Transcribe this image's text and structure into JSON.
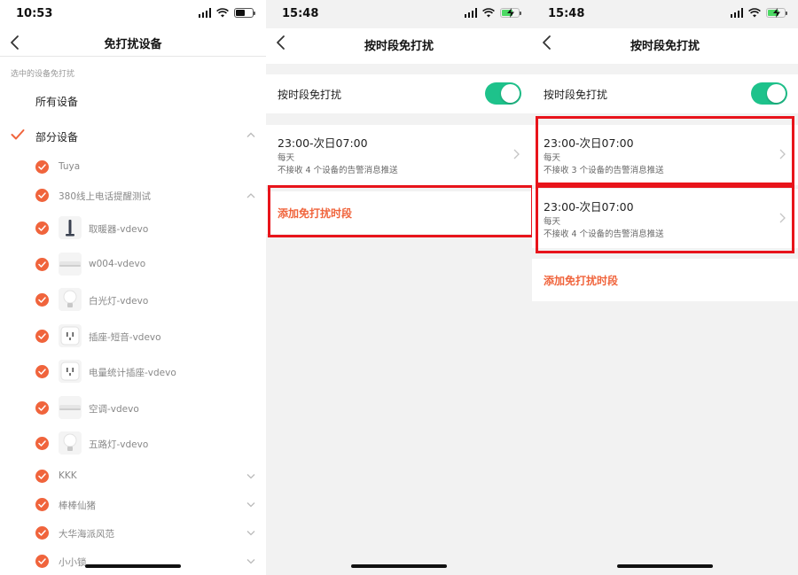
{
  "colors": {
    "accent": "#f0643c",
    "toggle_on": "#1ec28b",
    "highlight": "#e8141b"
  },
  "screen1": {
    "time": "10:53",
    "title": "免打扰设备",
    "section_label": "选中的设备免打扰",
    "options": [
      {
        "label": "所有设备",
        "checked": false
      },
      {
        "label": "部分设备",
        "checked": true
      }
    ],
    "devices": [
      {
        "label": "Tuya",
        "expand": "none",
        "icon": "none"
      },
      {
        "label": "380线上电话提醒测试",
        "expand": "up",
        "icon": "none"
      },
      {
        "label": "取暖器-vdevo",
        "expand": "none",
        "icon": "heater-icon"
      },
      {
        "label": "w004-vdevo",
        "expand": "none",
        "icon": "sensor-icon"
      },
      {
        "label": "白光灯-vdevo",
        "expand": "none",
        "icon": "bulb-icon"
      },
      {
        "label": "插座-短音-vdevo",
        "expand": "none",
        "icon": "socket-icon"
      },
      {
        "label": "电量统计插座-vdevo",
        "expand": "none",
        "icon": "socket-icon"
      },
      {
        "label": "空调-vdevo",
        "expand": "none",
        "icon": "sensor-icon"
      },
      {
        "label": "五路灯-vdevo",
        "expand": "none",
        "icon": "bulb-icon"
      },
      {
        "label": "KKK",
        "expand": "down",
        "icon": "none"
      },
      {
        "label": "棒棒仙猪",
        "expand": "down",
        "icon": "none"
      },
      {
        "label": "大华海派风范",
        "expand": "down",
        "icon": "none"
      },
      {
        "label": "小小锁",
        "expand": "down",
        "icon": "none"
      }
    ]
  },
  "screen2": {
    "time": "15:48",
    "title": "按时段免打扰",
    "toggle_label": "按时段免打扰",
    "toggle_on": true,
    "periods": [
      {
        "time": "23:00-次日07:00",
        "repeat": "每天",
        "desc": "不接收 4 个设备的告警消息推送"
      }
    ],
    "add_label": "添加免打扰时段"
  },
  "screen3": {
    "time": "15:48",
    "title": "按时段免打扰",
    "toggle_label": "按时段免打扰",
    "toggle_on": true,
    "periods": [
      {
        "time": "23:00-次日07:00",
        "repeat": "每天",
        "desc": "不接收 3 个设备的告警消息推送"
      },
      {
        "time": "23:00-次日07:00",
        "repeat": "每天",
        "desc": "不接收 4 个设备的告警消息推送"
      }
    ],
    "add_label": "添加免打扰时段"
  }
}
